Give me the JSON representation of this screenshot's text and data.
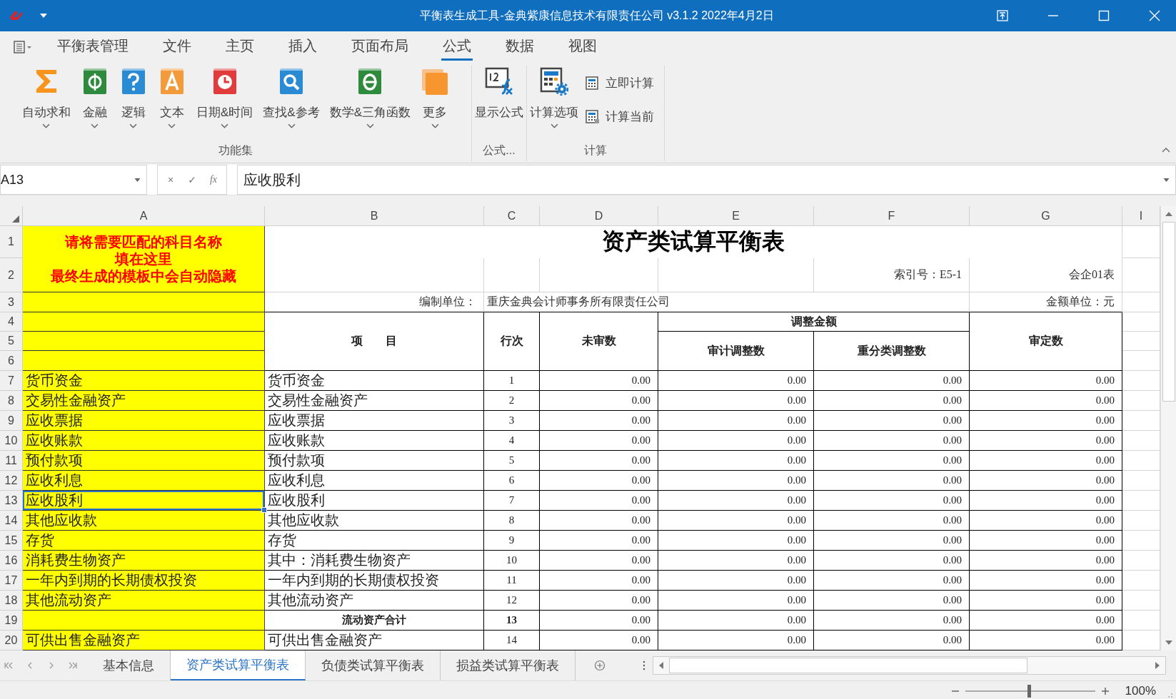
{
  "window": {
    "title": "平衡表生成工具-金典紫康信息技术有限责任公司 v3.1.2 2022年4月2日"
  },
  "menu": {
    "tabs": [
      {
        "label": "平衡表管理",
        "selected": false
      },
      {
        "label": "文件",
        "selected": false
      },
      {
        "label": "主页",
        "selected": false
      },
      {
        "label": "插入",
        "selected": false
      },
      {
        "label": "页面布局",
        "selected": false
      },
      {
        "label": "公式",
        "selected": true
      },
      {
        "label": "数据",
        "selected": false
      },
      {
        "label": "视图",
        "selected": false
      }
    ]
  },
  "ribbon": {
    "groups": [
      {
        "label": "功能集",
        "buttons": [
          {
            "label": "自动求和",
            "dropdown": true
          },
          {
            "label": "金融",
            "dropdown": true
          },
          {
            "label": "逻辑",
            "dropdown": true
          },
          {
            "label": "文本",
            "dropdown": true
          },
          {
            "label": "日期&时间",
            "dropdown": true
          },
          {
            "label": "查找&参考",
            "dropdown": true
          },
          {
            "label": "数学&三角函数",
            "dropdown": true
          },
          {
            "label": "更多",
            "dropdown": true
          }
        ]
      },
      {
        "label": "公式...",
        "buttons": [
          {
            "label": "显示公式",
            "dropdown": false
          }
        ]
      },
      {
        "label": "计算",
        "buttons": [
          {
            "label": "计算选项",
            "dropdown": true
          }
        ],
        "small_buttons": [
          {
            "label": "立即计算"
          },
          {
            "label": "计算当前"
          }
        ]
      }
    ]
  },
  "formula_bar": {
    "cell": "A13",
    "cancel": "×",
    "enter": "✓",
    "fx": "fx",
    "value": "应收股利"
  },
  "sheet": {
    "columns": [
      "A",
      "B",
      "C",
      "D",
      "E",
      "F",
      "G",
      "I"
    ],
    "row_numbers": [
      "1",
      "2",
      "3",
      "4",
      "5",
      "6"
    ],
    "note": [
      "请将需要匹配的科目名称",
      "填在这里",
      "最终生成的模板中会自动隐藏"
    ],
    "title": "资产类试算平衡表",
    "index_no": "索引号：E5-1",
    "form_no": "会企01表",
    "unit_label": "编制单位：",
    "unit_name": "重庆金典会计师事务所有限责任公司",
    "amount_unit": "金额单位：元",
    "headers": {
      "item": "项　　目",
      "line": "行次",
      "unaudited": "未审数",
      "adjustment": "调整金额",
      "audit_adjust": "审计调整数",
      "reclass_adjust": "重分类调整数",
      "audited": "审定数"
    },
    "rows": [
      {
        "row": "7",
        "kind": "item",
        "a": "货币资金",
        "b": "货币资金",
        "c": "1",
        "d": "0.00",
        "e": "0.00",
        "f": "0.00",
        "g": "0.00",
        "selected": false
      },
      {
        "row": "8",
        "kind": "item",
        "a": "交易性金融资产",
        "b": "交易性金融资产",
        "c": "2",
        "d": "0.00",
        "e": "0.00",
        "f": "0.00",
        "g": "0.00",
        "selected": false
      },
      {
        "row": "9",
        "kind": "item",
        "a": "应收票据",
        "b": "应收票据",
        "c": "3",
        "d": "0.00",
        "e": "0.00",
        "f": "0.00",
        "g": "0.00",
        "selected": false
      },
      {
        "row": "10",
        "kind": "item",
        "a": "应收账款",
        "b": "应收账款",
        "c": "4",
        "d": "0.00",
        "e": "0.00",
        "f": "0.00",
        "g": "0.00",
        "selected": false
      },
      {
        "row": "11",
        "kind": "item",
        "a": "预付款项",
        "b": "预付款项",
        "c": "5",
        "d": "0.00",
        "e": "0.00",
        "f": "0.00",
        "g": "0.00",
        "selected": false
      },
      {
        "row": "12",
        "kind": "item",
        "a": "应收利息",
        "b": "应收利息",
        "c": "6",
        "d": "0.00",
        "e": "0.00",
        "f": "0.00",
        "g": "0.00",
        "selected": false
      },
      {
        "row": "13",
        "kind": "item",
        "a": "应收股利",
        "b": "应收股利",
        "c": "7",
        "d": "0.00",
        "e": "0.00",
        "f": "0.00",
        "g": "0.00",
        "selected": true
      },
      {
        "row": "14",
        "kind": "item",
        "a": "其他应收款",
        "b": "其他应收款",
        "c": "8",
        "d": "0.00",
        "e": "0.00",
        "f": "0.00",
        "g": "0.00",
        "selected": false
      },
      {
        "row": "15",
        "kind": "item",
        "a": "存货",
        "b": "存货",
        "c": "9",
        "d": "0.00",
        "e": "0.00",
        "f": "0.00",
        "g": "0.00",
        "selected": false
      },
      {
        "row": "16",
        "kind": "item",
        "a": "消耗费生物资产",
        "b": "其中：消耗费生物资产",
        "c": "10",
        "d": "0.00",
        "e": "0.00",
        "f": "0.00",
        "g": "0.00",
        "selected": false
      },
      {
        "row": "17",
        "kind": "item",
        "a": "一年内到期的长期债权投资",
        "b": "一年内到期的长期债权投资",
        "c": "11",
        "d": "0.00",
        "e": "0.00",
        "f": "0.00",
        "g": "0.00",
        "selected": false
      },
      {
        "row": "18",
        "kind": "item",
        "a": "其他流动资产",
        "b": "其他流动资产",
        "c": "12",
        "d": "0.00",
        "e": "0.00",
        "f": "0.00",
        "g": "0.00",
        "selected": false
      },
      {
        "row": "19",
        "kind": "subtotal",
        "b": "流动资产合计",
        "c": "13",
        "d": "0.00",
        "e": "0.00",
        "f": "0.00",
        "g": "0.00",
        "selected": false
      },
      {
        "row": "20",
        "kind": "item",
        "a": "可供出售金融资产",
        "b": "可供出售金融资产",
        "c": "14",
        "d": "0.00",
        "e": "0.00",
        "f": "0.00",
        "g": "0.00",
        "selected": false
      }
    ]
  },
  "sheet_tabs": [
    {
      "label": "基本信息",
      "selected": false
    },
    {
      "label": "资产类试算平衡表",
      "selected": true
    },
    {
      "label": "负债类试算平衡表",
      "selected": false
    },
    {
      "label": "损益类试算平衡表",
      "selected": false
    }
  ],
  "zoom": {
    "level": 0.49,
    "reading": "100%"
  }
}
